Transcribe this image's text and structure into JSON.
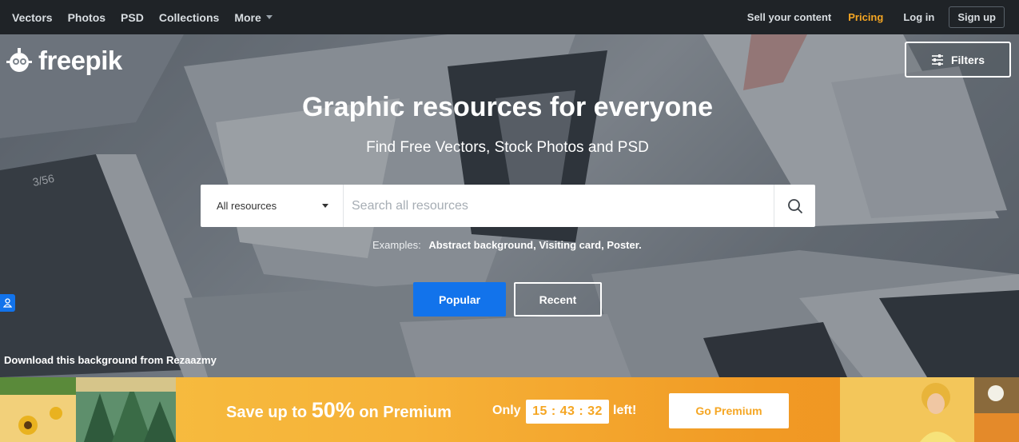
{
  "nav": {
    "links": [
      "Vectors",
      "Photos",
      "PSD",
      "Collections"
    ],
    "more_label": "More",
    "sell_label": "Sell your content",
    "pricing_label": "Pricing",
    "login_label": "Log in",
    "signup_label": "Sign up"
  },
  "logo": {
    "text": "freepik"
  },
  "filters": {
    "label": "Filters"
  },
  "hero": {
    "title": "Graphic resources for everyone",
    "subtitle": "Find Free Vectors, Stock Photos and PSD"
  },
  "search": {
    "category": "All resources",
    "placeholder": "Search all resources"
  },
  "examples": {
    "label": "Examples:",
    "items": [
      "Abstract background,",
      "Visiting card,",
      "Poster."
    ]
  },
  "sort_buttons": {
    "popular": "Popular",
    "recent": "Recent"
  },
  "credit": "Download this background from Rezaazmy",
  "promo": {
    "text_before": "Save up to",
    "percent": "50%",
    "text_after": "on Premium",
    "only_label": "Only",
    "timer": "15 : 43 : 32",
    "left_label": "left!",
    "cta": "Go Premium"
  },
  "colors": {
    "accent_blue": "#1273eb",
    "pricing_orange": "#f5a623",
    "topbar": "#1f2327"
  },
  "icons": [
    "freepik-logo-icon",
    "filters-sliders-icon",
    "search-icon",
    "caret-down-icon",
    "user-badge-icon"
  ]
}
